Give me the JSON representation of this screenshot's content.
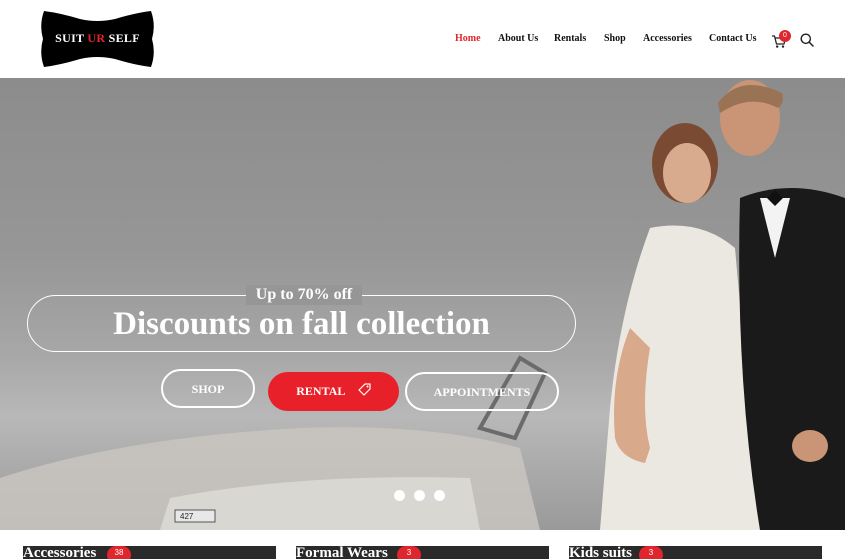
{
  "brand": {
    "logo_main": "SUIT ",
    "logo_ur": "UR",
    "logo_end": " SELF"
  },
  "nav": {
    "items": [
      {
        "label": "Home",
        "active": true
      },
      {
        "label": "About Us"
      },
      {
        "label": "Rentals"
      },
      {
        "label": "Shop"
      },
      {
        "label": "Accessories"
      },
      {
        "label": "Contact Us"
      }
    ],
    "cart_count": "0",
    "cart_icon": "cart-icon",
    "search_icon": "search-icon"
  },
  "hero": {
    "subtitle": "Up to 70% off",
    "title": "Discounts on fall collection",
    "buttons": {
      "shop": "SHOP",
      "rental": "RENTAL",
      "appointments": "APPOINTMENTS"
    },
    "plate": "427"
  },
  "categories": [
    {
      "label": "Accessories",
      "count": "38"
    },
    {
      "label": "Formal Wears",
      "count": "3"
    },
    {
      "label": "Kids suits",
      "count": "3"
    }
  ],
  "colors": {
    "accent": "#e0262c",
    "text": "#111111"
  }
}
